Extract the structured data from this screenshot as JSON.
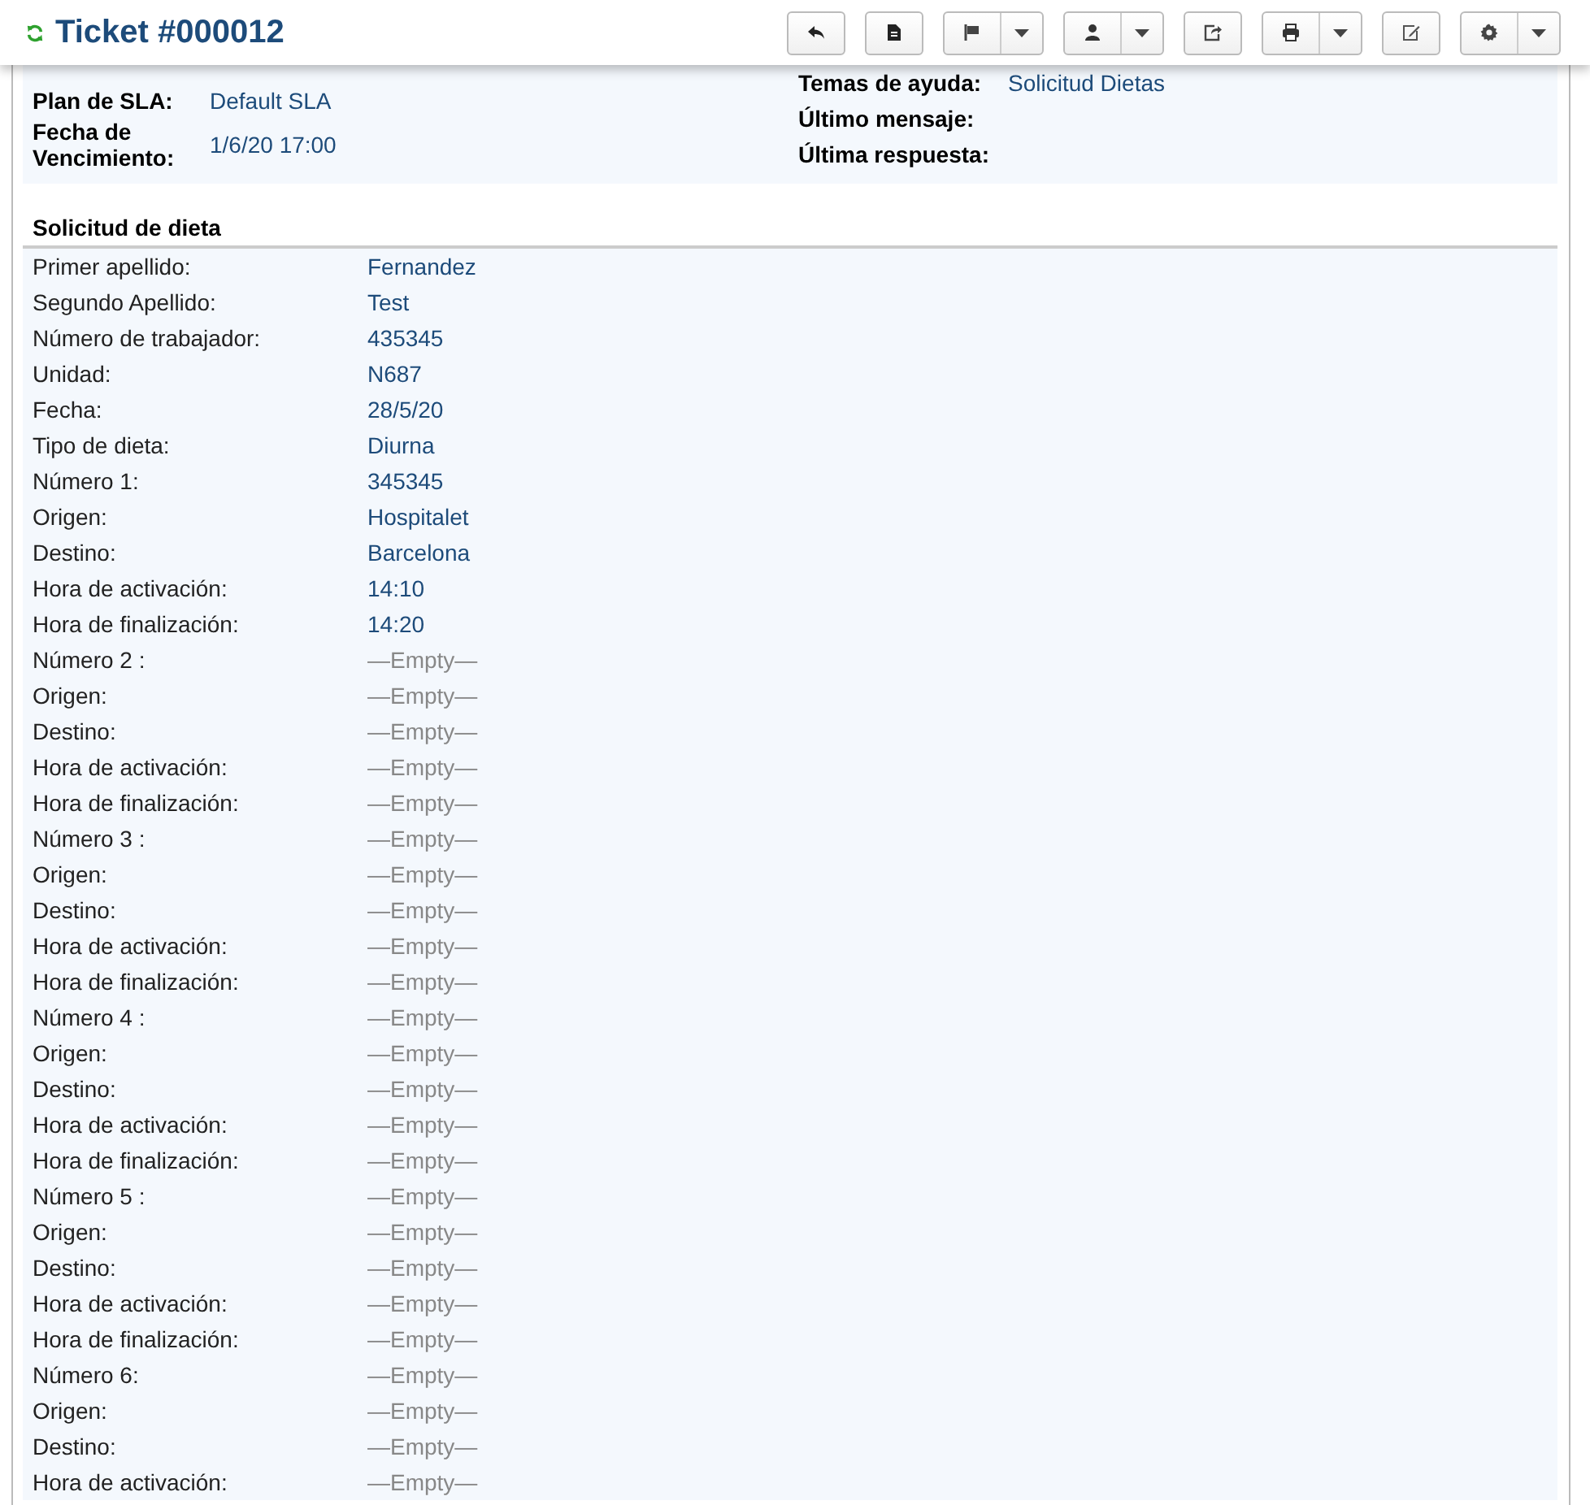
{
  "header": {
    "title": "Ticket #000012",
    "buttons": [
      {
        "kind": "reply",
        "split": false
      },
      {
        "kind": "document",
        "split": false
      },
      {
        "kind": "flag",
        "split": true
      },
      {
        "kind": "user",
        "split": true
      },
      {
        "kind": "share",
        "split": false
      },
      {
        "kind": "print",
        "split": true
      },
      {
        "kind": "edit",
        "split": false
      },
      {
        "kind": "gear",
        "split": true
      }
    ]
  },
  "info": {
    "left": [
      {
        "label": "Plan de SLA:",
        "value": "Default SLA",
        "empty": false
      },
      {
        "label": "Fecha de Vencimiento:",
        "value": "1/6/20 17:00",
        "empty": false
      }
    ],
    "right": [
      {
        "label": "Temas de ayuda:",
        "value": "Solicitud Dietas",
        "empty": false
      },
      {
        "label": "Último mensaje:"
      },
      {
        "label": "Última respuesta:"
      }
    ]
  },
  "section": {
    "title": "Solicitud de dieta",
    "fields": [
      {
        "label": "Primer apellido:",
        "value": "Fernandez",
        "empty": false
      },
      {
        "label": "Segundo Apellido:",
        "value": "Test",
        "empty": false
      },
      {
        "label": "Número de trabajador:",
        "value": "435345",
        "empty": false
      },
      {
        "label": "Unidad:",
        "value": "N687",
        "empty": false
      },
      {
        "label": "Fecha:",
        "value": "28/5/20",
        "empty": false
      },
      {
        "label": "Tipo de dieta:",
        "value": "Diurna",
        "empty": false
      },
      {
        "label": "Número 1:",
        "value": "345345",
        "empty": false
      },
      {
        "label": "Origen:",
        "value": "Hospitalet",
        "empty": false
      },
      {
        "label": "Destino:",
        "value": "Barcelona",
        "empty": false
      },
      {
        "label": "Hora de activación:",
        "value": "14:10",
        "empty": false
      },
      {
        "label": "Hora de finalización:",
        "value": "14:20",
        "empty": false
      },
      {
        "label": "Número 2 :",
        "value": "—Empty—",
        "empty": true
      },
      {
        "label": "Origen:",
        "value": "—Empty—",
        "empty": true
      },
      {
        "label": "Destino:",
        "value": "—Empty—",
        "empty": true
      },
      {
        "label": "Hora de activación:",
        "value": "—Empty—",
        "empty": true
      },
      {
        "label": "Hora de finalización:",
        "value": "—Empty—",
        "empty": true
      },
      {
        "label": "Número 3 :",
        "value": "—Empty—",
        "empty": true
      },
      {
        "label": "Origen:",
        "value": "—Empty—",
        "empty": true
      },
      {
        "label": "Destino:",
        "value": "—Empty—",
        "empty": true
      },
      {
        "label": "Hora de activación:",
        "value": "—Empty—",
        "empty": true
      },
      {
        "label": "Hora de finalización:",
        "value": "—Empty—",
        "empty": true
      },
      {
        "label": "Número 4 :",
        "value": "—Empty—",
        "empty": true
      },
      {
        "label": "Origen:",
        "value": "—Empty—",
        "empty": true
      },
      {
        "label": "Destino:",
        "value": "—Empty—",
        "empty": true
      },
      {
        "label": "Hora de activación:",
        "value": "—Empty—",
        "empty": true
      },
      {
        "label": "Hora de finalización:",
        "value": "—Empty—",
        "empty": true
      },
      {
        "label": "Número 5 :",
        "value": "—Empty—",
        "empty": true
      },
      {
        "label": "Origen:",
        "value": "—Empty—",
        "empty": true
      },
      {
        "label": "Destino:",
        "value": "—Empty—",
        "empty": true
      },
      {
        "label": "Hora de activación:",
        "value": "—Empty—",
        "empty": true
      },
      {
        "label": "Hora de finalización:",
        "value": "—Empty—",
        "empty": true
      },
      {
        "label": "Número 6:",
        "value": "—Empty—",
        "empty": true
      },
      {
        "label": "Origen:",
        "value": "—Empty—",
        "empty": true
      },
      {
        "label": "Destino:",
        "value": "—Empty—",
        "empty": true
      },
      {
        "label": "Hora de activación:",
        "value": "—Empty—",
        "empty": true
      }
    ]
  }
}
